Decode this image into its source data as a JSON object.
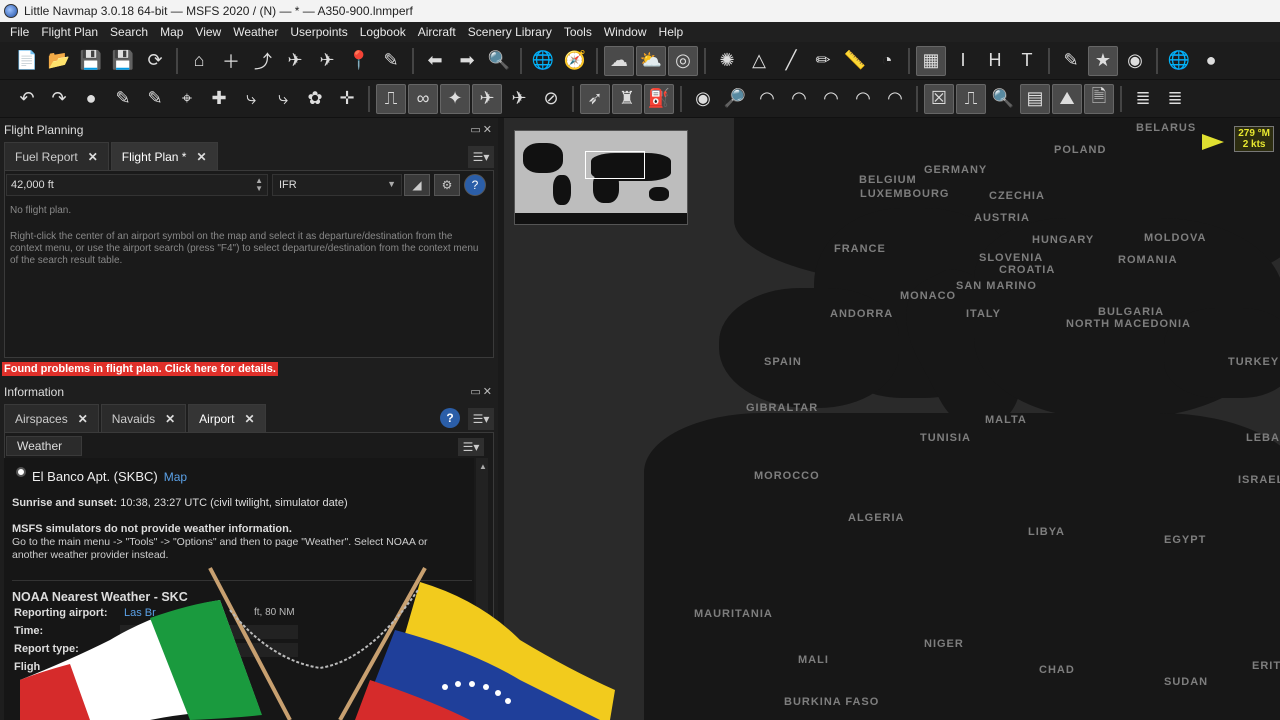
{
  "window": {
    "title": "Little Navmap 3.0.18 64-bit — MSFS 2020 / (N) — * — A350-900.lnmperf"
  },
  "menu": [
    "File",
    "Flight Plan",
    "Search",
    "Map",
    "View",
    "Weather",
    "Userpoints",
    "Logbook",
    "Aircraft",
    "Scenery Library",
    "Tools",
    "Window",
    "Help"
  ],
  "toolbar1_icons": [
    "new-icon",
    "open-icon",
    "save-icon",
    "save-as-icon",
    "reload-icon",
    "home-icon",
    "add-icon",
    "route-icon",
    "airplane-icon",
    "airplane-2-icon",
    "pin-icon",
    "mark-icon",
    "back-icon",
    "forward-icon",
    "search-doc-icon",
    "globe-icon",
    "compass-icon",
    "cloud-icon",
    "weather-icon",
    "circle-grid-icon",
    "target-icon",
    "triangle-icon",
    "line-icon",
    "pencil-icon",
    "ruler-icon",
    "dial-icon",
    "grid-icon",
    "text-icon",
    "text-2-icon",
    "text-3-icon",
    "tools-icon",
    "star-icon",
    "target-2-icon",
    "globe-2-icon",
    "record-icon"
  ],
  "toolbar2_icons": [
    "undo-icon",
    "redo-icon",
    "ball-icon",
    "edit-icon",
    "edit-2-icon",
    "cursor-icon",
    "add-point-icon",
    "leg-icon",
    "leg-2-icon",
    "flower-icon",
    "cross-icon",
    "route-active-icon",
    "loop-icon",
    "star-shape-icon",
    "plane-active-icon",
    "plane-small-icon",
    "ban-icon",
    "arrow-plane-icon",
    "tower-icon",
    "fuel-icon",
    "circle-icon",
    "magnify-icon",
    "dome-icon",
    "dome-2-icon",
    "dome-3-icon",
    "dome-4-icon",
    "dome-5-icon",
    "x-box-icon",
    "route-box-icon",
    "zoom-box-icon",
    "chart-icon",
    "terrain-icon",
    "doc-icon",
    "stack-icon",
    "stack-2-icon"
  ],
  "flight_planning": {
    "dock_title": "Flight Planning",
    "tabs": [
      {
        "label": "Fuel Report",
        "selected": false
      },
      {
        "label": "Flight Plan *",
        "selected": true
      }
    ],
    "altitude": "42,000 ft",
    "rules": "IFR",
    "empty_text": "No flight plan.",
    "hint_text": "Right-click the center of an airport symbol on the map and select it as departure/destination from the context menu, or use the airport search (press \"F4\") to select departure/destination from the context menu of the search result table.",
    "warning": "Found problems in flight plan. Click here for details."
  },
  "information": {
    "dock_title": "Information",
    "tabs": [
      {
        "label": "Airspaces",
        "selected": false
      },
      {
        "label": "Navaids",
        "selected": false
      },
      {
        "label": "Airport",
        "selected": true
      }
    ],
    "subtab": "Weather",
    "airport_title": "El Banco Apt. (SKBC)",
    "map_link": "Map",
    "sunrise_label": "Sunrise and sunset:",
    "sunrise_value": "10:38, 23:27 UTC (civil twilight, simulator date)",
    "msfs_title": "MSFS simulators do not provide weather information.",
    "msfs_text": "Go to the main menu -> \"Tools\" -> \"Options\" and then to page \"Weather\". Select NOAA or another weather provider instead.",
    "noaa_title": "NOAA Nearest Weather - SKC",
    "reporting_label": "Reporting airport:",
    "reporting_value": "Las Br",
    "reporting_tail": "ft, 80 NM",
    "time_label": "Time:",
    "report_type_label": "Report type:",
    "flight_label": "Fligh"
  },
  "map": {
    "wind_label_1": "279 °M",
    "wind_label_2": "2 kts",
    "countries": [
      {
        "name": "BELARUS"
      },
      {
        "name": "POLAND"
      },
      {
        "name": "GERMANY"
      },
      {
        "name": "BELGIUM"
      },
      {
        "name": "LUXEMBOURG"
      },
      {
        "name": "CZECHIA"
      },
      {
        "name": "AUSTRIA"
      },
      {
        "name": "HUNGARY"
      },
      {
        "name": "MOLDOVA"
      },
      {
        "name": "SLOVENIA"
      },
      {
        "name": "CROATIA"
      },
      {
        "name": "ROMANIA"
      },
      {
        "name": "FRANCE"
      },
      {
        "name": "MONACO"
      },
      {
        "name": "SAN MARINO"
      },
      {
        "name": "ANDORRA"
      },
      {
        "name": "ITALY"
      },
      {
        "name": "NORTH MACEDONIA"
      },
      {
        "name": "BULGARIA"
      },
      {
        "name": "SPAIN"
      },
      {
        "name": "TURKEY"
      },
      {
        "name": "GIBRALTAR"
      },
      {
        "name": "MALTA"
      },
      {
        "name": "LEBANON"
      },
      {
        "name": "TUNISIA"
      },
      {
        "name": "MOROCCO"
      },
      {
        "name": "ISRAEL"
      },
      {
        "name": "ALGERIA"
      },
      {
        "name": "LIBYA"
      },
      {
        "name": "EGYPT"
      },
      {
        "name": "MAURITANIA"
      },
      {
        "name": "MALI"
      },
      {
        "name": "NIGER"
      },
      {
        "name": "CHAD"
      },
      {
        "name": "ERITR"
      },
      {
        "name": "SUDAN"
      },
      {
        "name": "BURKINA FASO"
      }
    ]
  }
}
